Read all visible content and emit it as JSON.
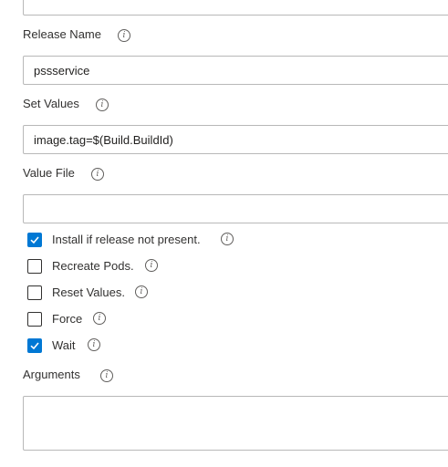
{
  "release_name": {
    "label": "Release Name",
    "value": "pssservice"
  },
  "set_values": {
    "label": "Set Values",
    "value": "image.tag=$(Build.BuildId)"
  },
  "value_file": {
    "label": "Value File",
    "value": ""
  },
  "options": [
    {
      "label": "Install if release not present.",
      "checked": true
    },
    {
      "label": "Recreate Pods.",
      "checked": false
    },
    {
      "label": "Reset Values.",
      "checked": false
    },
    {
      "label": "Force",
      "checked": false
    },
    {
      "label": "Wait",
      "checked": true
    }
  ],
  "arguments": {
    "label": "Arguments",
    "value": ""
  },
  "info_icon_glyph": "i",
  "colors": {
    "accent": "#0078d4",
    "border": "#b8b8b8",
    "text": "#323130"
  }
}
